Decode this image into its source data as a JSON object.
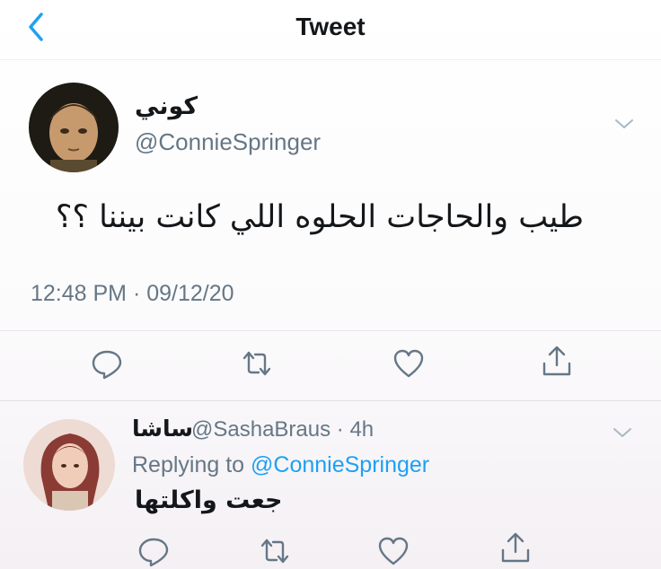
{
  "header": {
    "title": "Tweet"
  },
  "tweet": {
    "display_name": "كوني",
    "handle": "@ConnieSpringer",
    "text": "طيب والحاجات الحلوه اللي كانت بيننا ؟؟",
    "timestamp": "12:48 PM · 09/12/20"
  },
  "reply": {
    "display_name": "ساشا",
    "handle_time": "@SashaBraus · 4h",
    "replying_prefix": "Replying to ",
    "replying_mention": "@ConnieSpringer",
    "text": "جعت واكلتها"
  },
  "icons": [
    "back-chevron",
    "chevron-down",
    "reply",
    "retweet",
    "like",
    "share"
  ],
  "colors": {
    "accent": "#1da1f2",
    "secondary_text": "#657786",
    "icon": "#657786"
  }
}
